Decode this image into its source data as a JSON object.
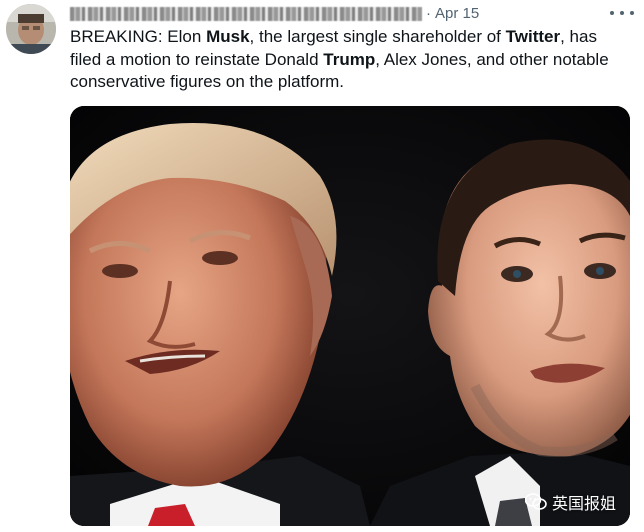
{
  "tweet": {
    "date": "Apr 15",
    "separator": "·",
    "text_segments": [
      {
        "text": "BREAKING: Elon ",
        "bold": false
      },
      {
        "text": "Musk",
        "bold": true
      },
      {
        "text": ", the largest single shareholder of ",
        "bold": false
      },
      {
        "text": "Twitter",
        "bold": true
      },
      {
        "text": ", has filed a motion to reinstate Donald ",
        "bold": false
      },
      {
        "text": "Trump",
        "bold": true
      },
      {
        "text": ", Alex Jones, and other notable conservative figures on the platform.",
        "bold": false
      }
    ]
  },
  "media": {
    "watermark_text": "英国报姐",
    "background_color": "#050506"
  },
  "icons": {
    "more": "more-horizontal-icon",
    "watermark": "wechat-icon"
  }
}
